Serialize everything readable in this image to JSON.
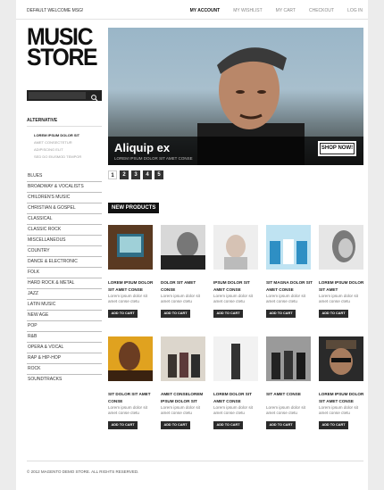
{
  "header": {
    "welcome": "DEFAULT WELCOME MSG!",
    "links": [
      "MY ACCOUNT",
      "MY WISHLIST",
      "MY CART",
      "CHECKOUT",
      "LOG IN"
    ]
  },
  "logo": {
    "line1": "MUSIC",
    "line2": "STORE"
  },
  "search": {
    "placeholder": ""
  },
  "sidebar": {
    "alt_title": "ALTERNATIVE",
    "alt_items": [
      "LOREM IPSUM DOLOR SIT",
      "AMET CONSECTETUR",
      "ADIPISCING ELIT",
      "SED DO EIUSMOD TEMPOR"
    ],
    "categories": [
      "BLUES",
      "BROADWAY & VOCALISTS",
      "CHILDREN'S MUSIC",
      "CHRISTIAN & GOSPEL",
      "CLASSICAL",
      "CLASSIC ROCK",
      "MISCELLANEOUS",
      "COUNTRY",
      "DANCE & ELECTRONIC",
      "FOLK",
      "HARD ROCK & METAL",
      "JAZZ",
      "LATIN MUSIC",
      "NEW AGE",
      "POP",
      "R&B",
      "OPERA & VOCAL",
      "RAP & HIP-HOP",
      "ROCK",
      "SOUNDTRACKS"
    ]
  },
  "banner": {
    "title": "Aliquip ex",
    "subtitle": "LOREM IPSUM DOLOR SIT AMET CONSE",
    "button": "SHOP NOW!"
  },
  "pager": [
    "1",
    "2",
    "3",
    "4",
    "5"
  ],
  "new_products": {
    "title": "NEW PRODUCTS",
    "button_label": "ADD TO CART",
    "items": [
      {
        "name": "LOREM IPSUM DOLOR SIT AMET CONSE",
        "desc": "Lorem ipsum dolor sit amet conse ctetu"
      },
      {
        "name": "DOLOR SIT AMET CONSE",
        "desc": "Lorem ipsum dolor sit amet conse ctetu"
      },
      {
        "name": "IPSUM DOLOR SIT AMET CONSE",
        "desc": "Lorem ipsum dolor sit amet conse ctetu"
      },
      {
        "name": "SIT MAGNA DOLOR SIT AMET CONSE",
        "desc": "Lorem ipsum dolor sit amet conse ctetu"
      },
      {
        "name": "LOREM IPSUM DOLOR SIT AMET",
        "desc": "Lorem ipsum dolor sit amet conse ctetu"
      },
      {
        "name": "SIT DOLOR SIT AMET CONSE",
        "desc": "Lorem ipsum dolor sit amet conse ctetu"
      },
      {
        "name": "AMET CONSELOREM IPSUM DOLOR SIT",
        "desc": "Lorem ipsum dolor sit amet conse ctetu"
      },
      {
        "name": "LOREM DOLOR SIT AMET CONSE",
        "desc": "Lorem ipsum dolor sit amet conse ctetu"
      },
      {
        "name": "SIT AMET CONSE",
        "desc": "Lorem ipsum dolor sit amet conse ctetu"
      },
      {
        "name": "LOREM IPSUM DOLOR SIT AMET CONSE",
        "desc": "Lorem ipsum dolor sit amet conse ctetu"
      }
    ]
  },
  "footer": "© 2012 MAGENTO DEMO STORE. ALL RIGHTS RESERVED."
}
